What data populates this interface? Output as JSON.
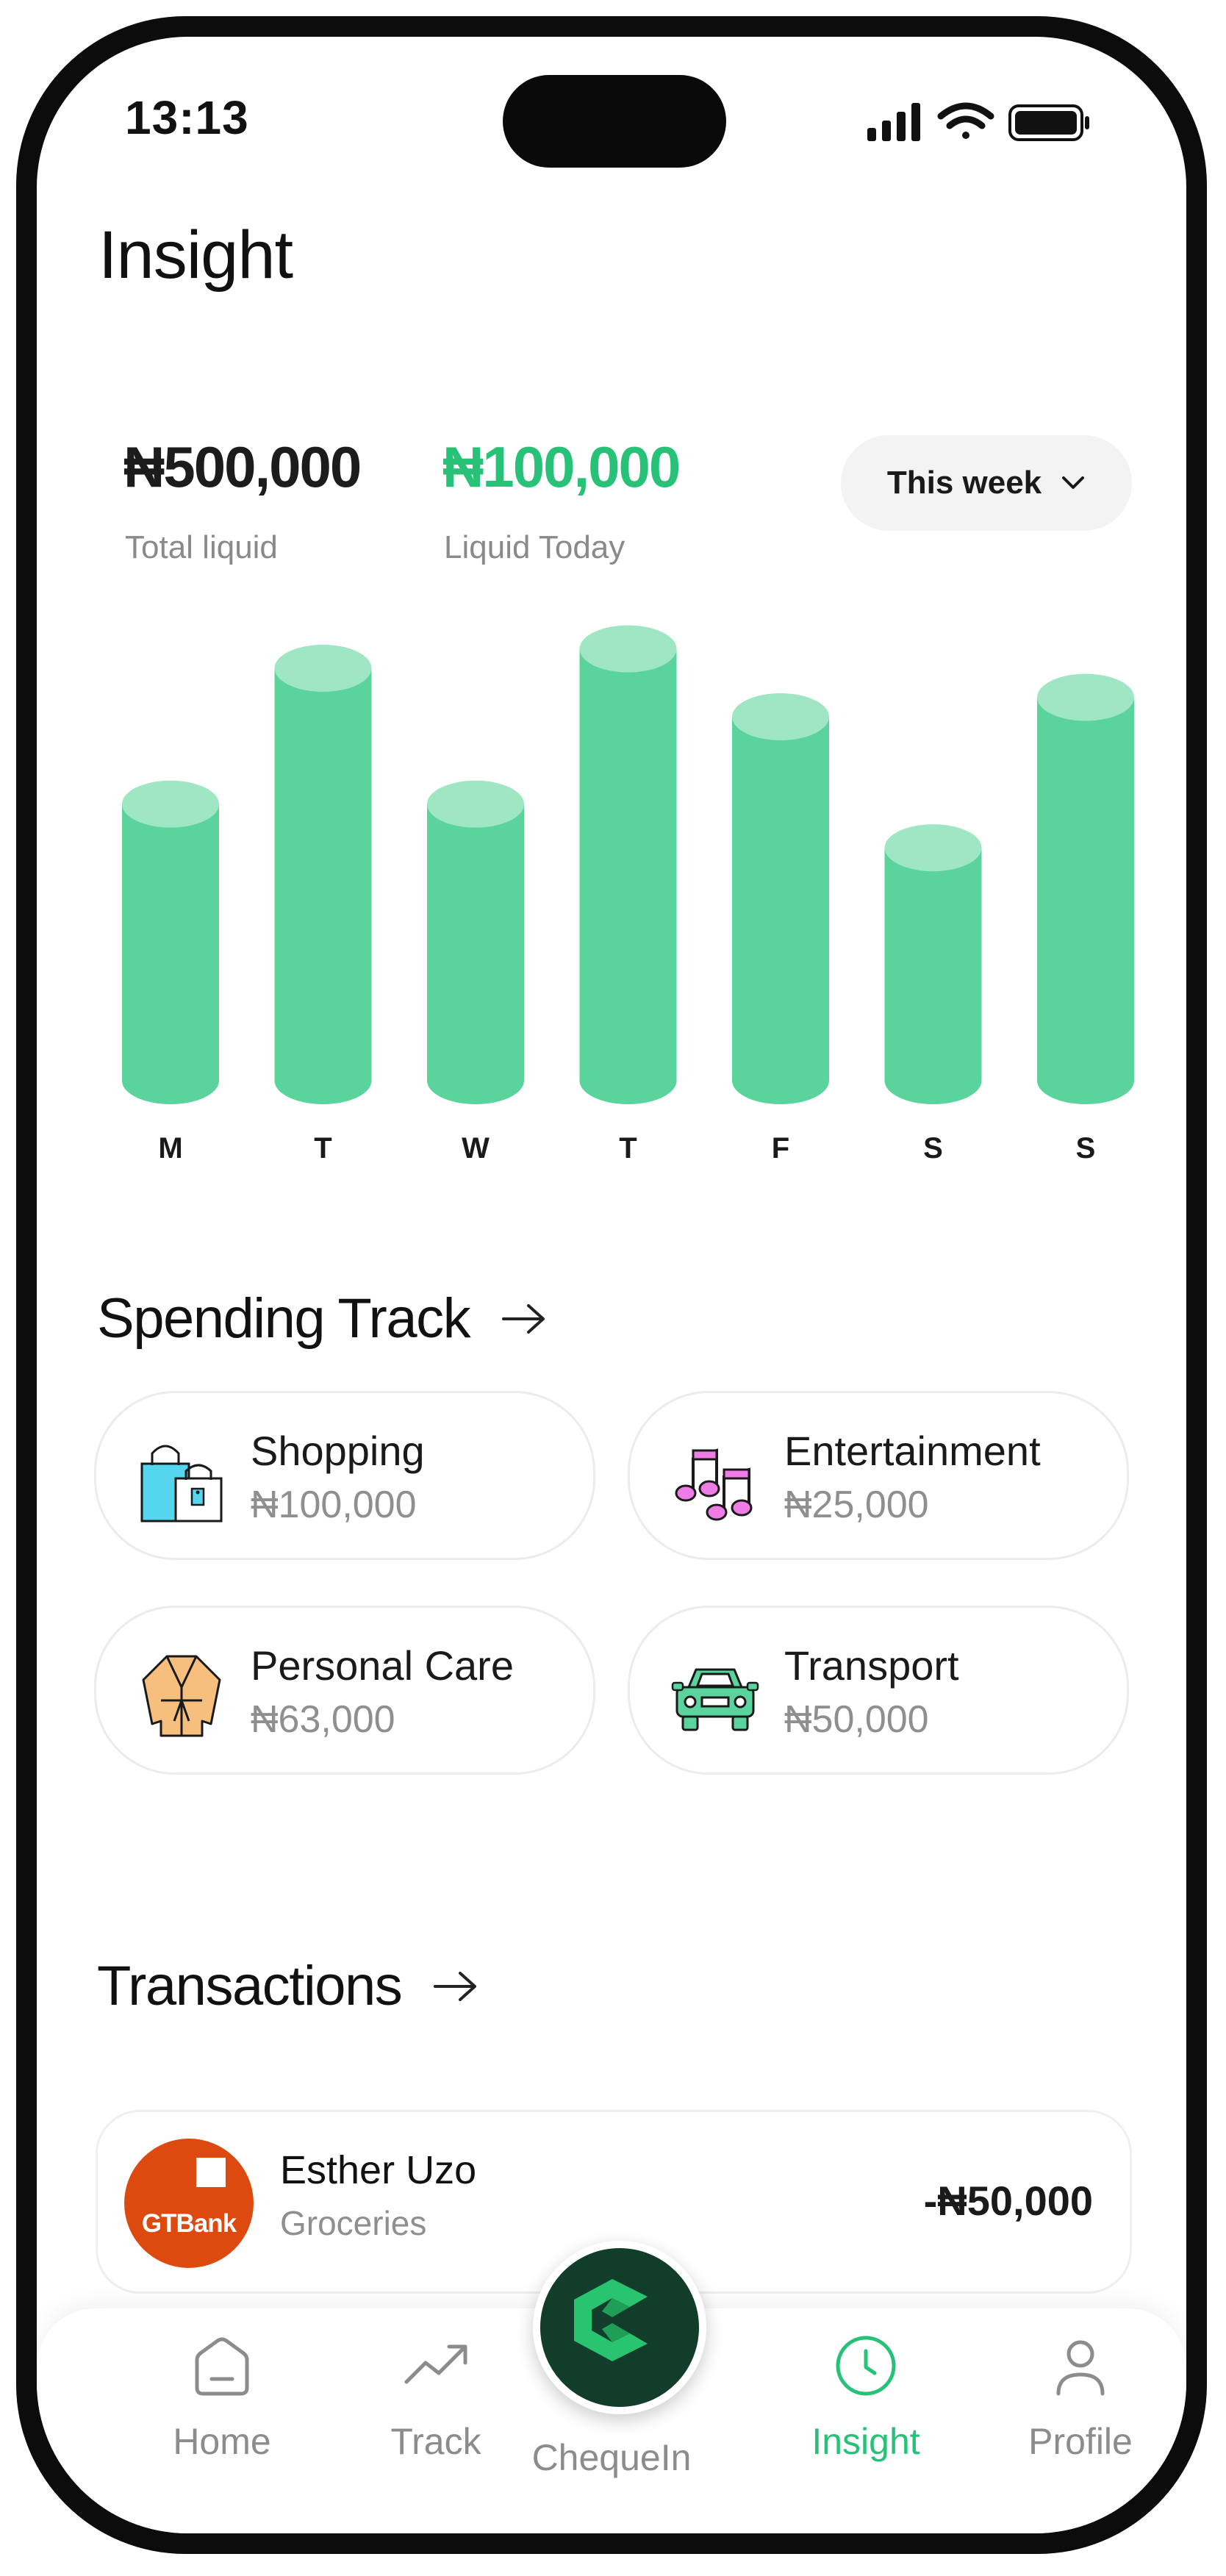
{
  "status_bar": {
    "time": "13:13"
  },
  "header": {
    "title": "Insight"
  },
  "summary": {
    "total_amount": "₦500,000",
    "total_label": "Total liquid",
    "today_amount": "₦100,000",
    "today_label": "Liquid Today",
    "period_selector": "This week"
  },
  "chart_data": {
    "type": "bar",
    "categories": [
      "M",
      "T",
      "W",
      "T",
      "F",
      "S",
      "S"
    ],
    "values": [
      0.57,
      0.85,
      0.57,
      0.89,
      0.75,
      0.48,
      0.79
    ],
    "title": "",
    "xlabel": "",
    "ylabel": "",
    "ylim": [
      0,
      1
    ],
    "grid": false,
    "colors": {
      "bar": "#5ad49c",
      "bar_top": "#9ee6c4"
    }
  },
  "spending": {
    "title": "Spending Track",
    "items": [
      {
        "name": "Shopping",
        "amount": "₦100,000",
        "icon": "shopping-bags-icon"
      },
      {
        "name": "Entertainment",
        "amount": "₦25,000",
        "icon": "music-notes-icon"
      },
      {
        "name": "Personal Care",
        "amount": "₦63,000",
        "icon": "robe-icon"
      },
      {
        "name": "Transport",
        "amount": "₦50,000",
        "icon": "car-icon"
      }
    ]
  },
  "transactions": {
    "title": "Transactions",
    "items": [
      {
        "bank": "GTBank",
        "name": "Esther Uzo",
        "category": "Groceries",
        "amount": "-₦50,000"
      }
    ]
  },
  "nav": {
    "items": [
      {
        "label": "Home",
        "icon": "home-icon"
      },
      {
        "label": "Track",
        "icon": "trend-icon"
      },
      {
        "label": "ChequeIn",
        "icon": "chequein-logo"
      },
      {
        "label": "Insight",
        "icon": "clock-icon"
      },
      {
        "label": "Profile",
        "icon": "person-icon"
      }
    ],
    "active": "Insight"
  },
  "colors": {
    "accent": "#27c277",
    "brand_dark": "#123d2a",
    "bank": "#dd4a0f"
  }
}
